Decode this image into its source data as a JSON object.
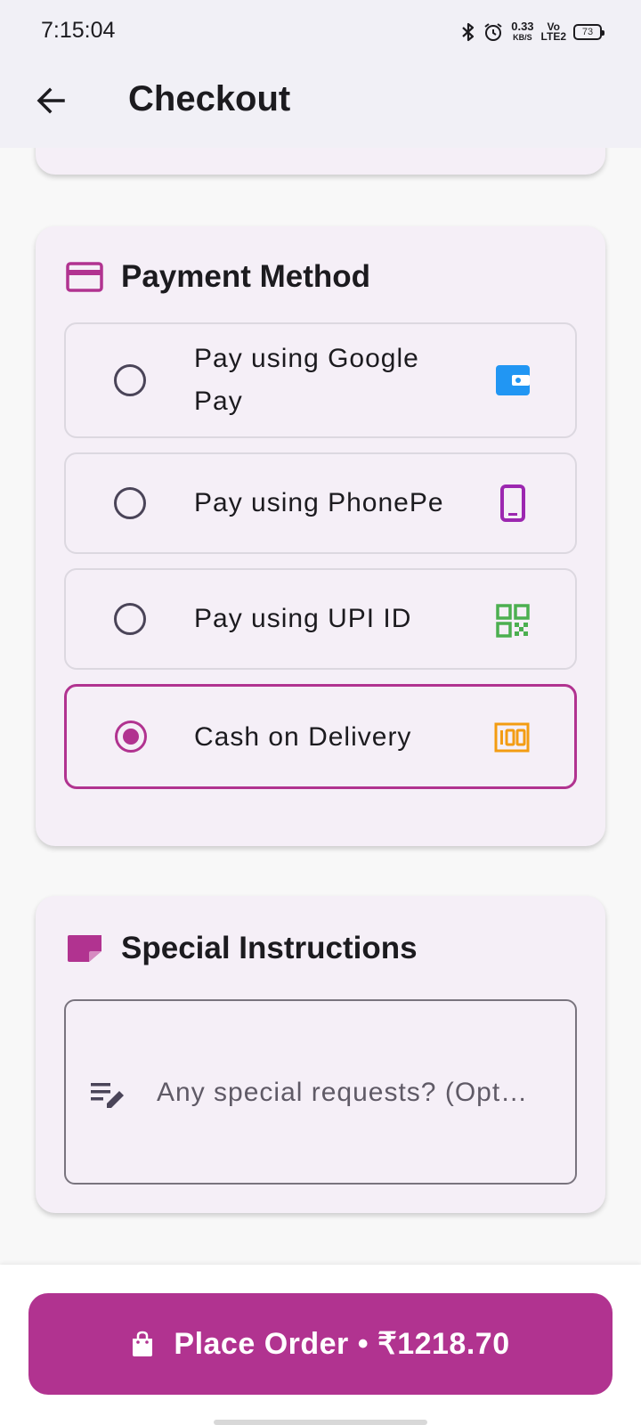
{
  "status_bar": {
    "time": "7:15:04",
    "net_speed": "0.33",
    "net_unit": "KB/S",
    "volte_top": "Vo",
    "volte_bottom": "LTE2",
    "battery": "73"
  },
  "header": {
    "title": "Checkout",
    "back_icon": "arrow-back-icon"
  },
  "payment": {
    "title": "Payment Method",
    "icon": "credit-card-icon",
    "accent": "#b13390",
    "options": [
      {
        "label": "Pay using Google Pay",
        "icon": "wallet-icon",
        "icon_color": "#2196f3",
        "selected": false
      },
      {
        "label": "Pay using PhonePe",
        "icon": "smartphone-icon",
        "icon_color": "#9c27b0",
        "selected": false
      },
      {
        "label": "Pay using UPI ID",
        "icon": "qr-code-icon",
        "icon_color": "#4caf50",
        "selected": false
      },
      {
        "label": "Cash on Delivery",
        "icon": "money-icon",
        "icon_color": "#f39c12",
        "selected": true
      }
    ]
  },
  "instructions": {
    "title": "Special Instructions",
    "icon": "sticky-note-icon",
    "placeholder": "Any special requests? (Opt…",
    "field_icon": "edit-note-icon"
  },
  "footer": {
    "button_label": "Place Order • ₹1218.70",
    "button_icon": "shopping-bag-icon",
    "button_color": "#b13390"
  }
}
